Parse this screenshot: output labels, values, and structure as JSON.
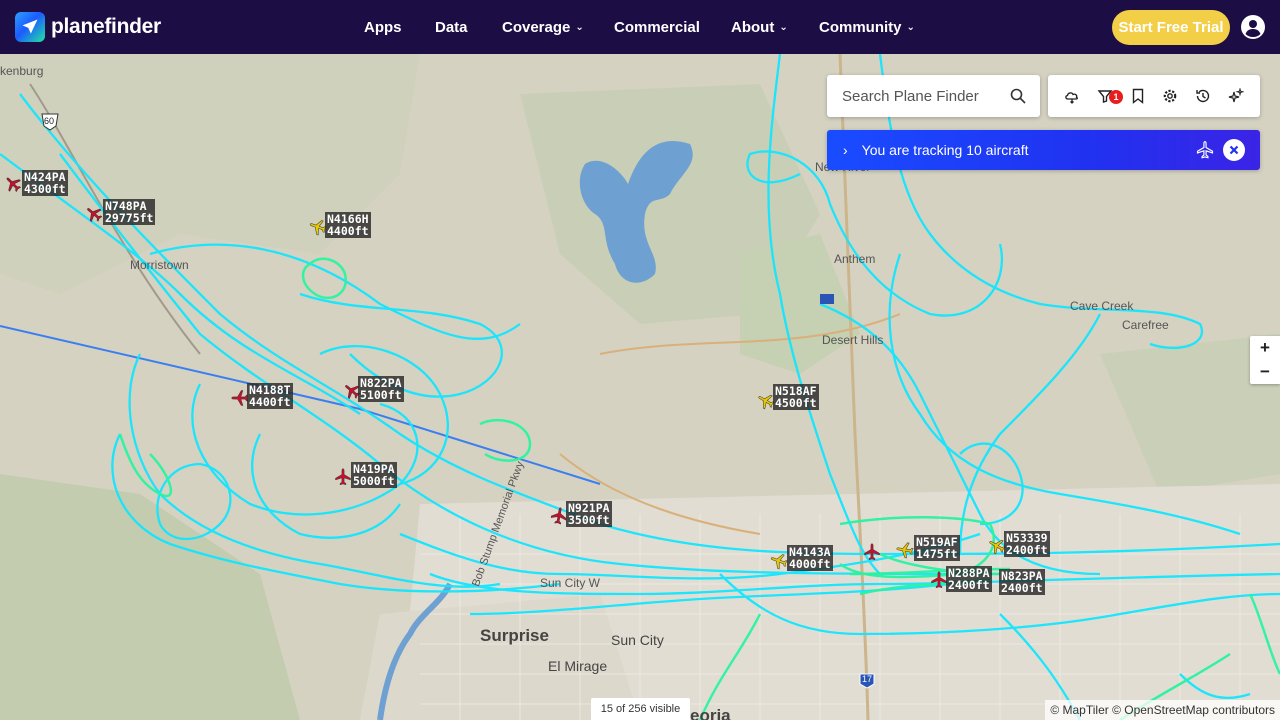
{
  "header": {
    "logo_text": "planefinder",
    "nav": [
      {
        "label": "Apps",
        "dropdown": false
      },
      {
        "label": "Data",
        "dropdown": false
      },
      {
        "label": "Coverage",
        "dropdown": true
      },
      {
        "label": "Commercial",
        "dropdown": false
      },
      {
        "label": "About",
        "dropdown": true
      },
      {
        "label": "Community",
        "dropdown": true
      }
    ],
    "cta_label": "Start Free Trial",
    "colors": {
      "bg": "#1c0d45",
      "cta": "#f3cf47"
    }
  },
  "search": {
    "placeholder": "Search Plane Finder"
  },
  "toolbar": {
    "icons": [
      "weather-icon",
      "filter-icon",
      "bookmark-icon",
      "settings-icon",
      "history-icon",
      "sparkle-icon"
    ],
    "filter_badge": "1"
  },
  "tracking": {
    "text": "You are tracking 10 aircraft"
  },
  "zoom": {
    "in": "+",
    "out": "−"
  },
  "visible_count": "15 of 256 visible",
  "attribution": "© MapTiler © OpenStreetMap contributors",
  "places": [
    {
      "name": "kenburg"
    },
    {
      "name": "Morristown"
    },
    {
      "name": "Anthem"
    },
    {
      "name": "Cave Creek"
    },
    {
      "name": "Carefree"
    },
    {
      "name": "Desert Hills"
    },
    {
      "name": "Surprise"
    },
    {
      "name": "Sun City"
    },
    {
      "name": "El Mirage"
    },
    {
      "name": "Bob Stump Memorial Pkwy"
    },
    {
      "name": "New River"
    },
    {
      "name": "eoria"
    },
    {
      "name": "Sun City W"
    }
  ],
  "aircraft": [
    {
      "callsign": "N424PA",
      "alt": "4300ft",
      "color": "#c8102e"
    },
    {
      "callsign": "N748PA",
      "alt": "29775ft",
      "color": "#c8102e"
    },
    {
      "callsign": "N4166H",
      "alt": "4400ft",
      "color": "#e8c800"
    },
    {
      "callsign": "N4188T",
      "alt": "4400ft",
      "color": "#c8102e"
    },
    {
      "callsign": "N822PA",
      "alt": "5100ft",
      "color": "#c8102e"
    },
    {
      "callsign": "N518AF",
      "alt": "4500ft",
      "color": "#e8c800"
    },
    {
      "callsign": "N419PA",
      "alt": "5000ft",
      "color": "#c8102e"
    },
    {
      "callsign": "N921PA",
      "alt": "3500ft",
      "color": "#c8102e"
    },
    {
      "callsign": "N4143A",
      "alt": "4000ft",
      "color": "#e8c800"
    },
    {
      "callsign": "N519AF",
      "alt": "1475ft",
      "color": "#e8c800"
    },
    {
      "callsign": "N53339",
      "alt": "2400ft",
      "color": "#e8c800"
    },
    {
      "callsign": "N288PA",
      "alt": "2400ft",
      "color": "#c8102e"
    },
    {
      "callsign": "N823PA",
      "alt": "2400ft",
      "color": "#c8102e"
    }
  ],
  "route_badges": [
    "60",
    "17"
  ]
}
